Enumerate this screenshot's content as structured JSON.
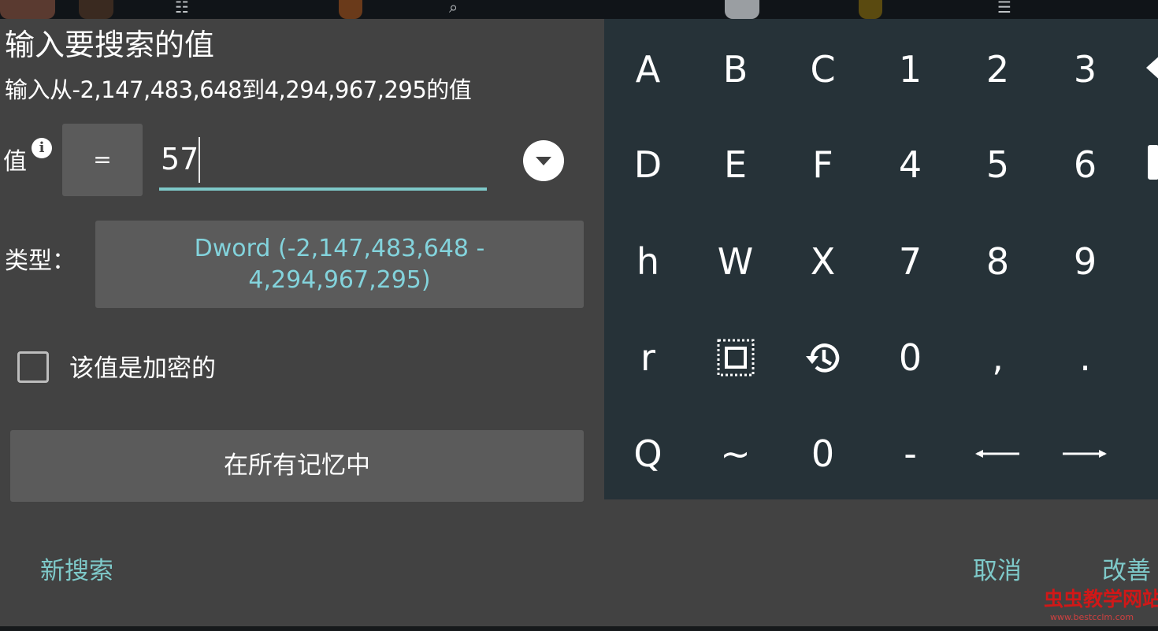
{
  "dialog": {
    "title": "输入要搜索的值",
    "subtitle": "输入从-2,147,483,648到4,294,967,295的值",
    "value_label": "值",
    "info_icon_glyph": "i",
    "operator": "=",
    "value": "57",
    "type_label": "类型：",
    "type_value": "Dword (-2,147,483,648 - 4,294,967,295)",
    "encrypted_label": "该值是加密的",
    "encrypted_checked": false,
    "memory_region": "在所有记忆中",
    "footer": {
      "new_search": "新搜索",
      "cancel": "取消",
      "refine": "改善"
    }
  },
  "keyboard": {
    "rows": [
      [
        "A",
        "B",
        "C",
        "1",
        "2",
        "3"
      ],
      [
        "D",
        "E",
        "F",
        "4",
        "5",
        "6"
      ],
      [
        "h",
        "W",
        "X",
        "7",
        "8",
        "9"
      ],
      [
        "r",
        "",
        "",
        "0",
        ",",
        "."
      ],
      [
        "Q",
        "~",
        "0",
        "-",
        "",
        ""
      ]
    ],
    "icons": {
      "select_all": "select-all-icon",
      "history": "history-icon",
      "arrow_left": "arrow-left-icon",
      "arrow_right": "arrow-right-icon"
    }
  },
  "watermark": {
    "text": "虫虫教学网站",
    "url": "www.bestcclm.com"
  },
  "colors": {
    "dialog_bg": "#424242",
    "button_bg": "#5b5b5b",
    "keyboard_bg": "#263238",
    "accent": "#7ec9c9",
    "type_text": "#83d3dc"
  }
}
